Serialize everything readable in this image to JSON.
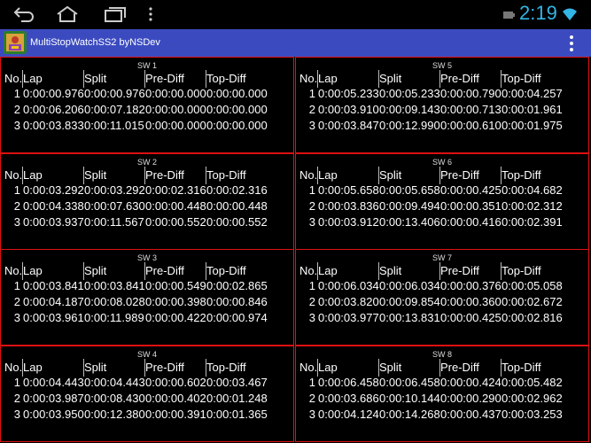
{
  "status_bar": {
    "time": "2:19"
  },
  "app": {
    "title": "MultiStopWatchSS2 byNSDev"
  },
  "columns": [
    "No.",
    "Lap",
    "Split",
    "Pre-Diff",
    "Top-Diff"
  ],
  "stopwatches": [
    {
      "title": "SW 1",
      "rows": [
        {
          "no": "1",
          "lap": "0:00:00.976",
          "split": "0:00:00.976",
          "pre": "0:00:00.000",
          "top": "0:00:00.000"
        },
        {
          "no": "2",
          "lap": "0:00:06.206",
          "split": "0:00:07.182",
          "pre": "0:00:00.000",
          "top": "0:00:00.000"
        },
        {
          "no": "3",
          "lap": "0:00:03.833",
          "split": "0:00:11.015",
          "pre": "0:00:00.000",
          "top": "0:00:00.000"
        }
      ]
    },
    {
      "title": "SW 5",
      "rows": [
        {
          "no": "1",
          "lap": "0:00:05.233",
          "split": "0:00:05.233",
          "pre": "0:00:00.790",
          "top": "0:00:04.257"
        },
        {
          "no": "2",
          "lap": "0:00:03.910",
          "split": "0:00:09.143",
          "pre": "0:00:00.713",
          "top": "0:00:01.961"
        },
        {
          "no": "3",
          "lap": "0:00:03.847",
          "split": "0:00:12.990",
          "pre": "0:00:00.610",
          "top": "0:00:01.975"
        }
      ]
    },
    {
      "title": "SW 2",
      "rows": [
        {
          "no": "1",
          "lap": "0:00:03.292",
          "split": "0:00:03.292",
          "pre": "0:00:02.316",
          "top": "0:00:02.316"
        },
        {
          "no": "2",
          "lap": "0:00:04.338",
          "split": "0:00:07.630",
          "pre": "0:00:00.448",
          "top": "0:00:00.448"
        },
        {
          "no": "3",
          "lap": "0:00:03.937",
          "split": "0:00:11.567",
          "pre": "0:00:00.552",
          "top": "0:00:00.552"
        }
      ]
    },
    {
      "title": "SW 6",
      "rows": [
        {
          "no": "1",
          "lap": "0:00:05.658",
          "split": "0:00:05.658",
          "pre": "0:00:00.425",
          "top": "0:00:04.682"
        },
        {
          "no": "2",
          "lap": "0:00:03.836",
          "split": "0:00:09.494",
          "pre": "0:00:00.351",
          "top": "0:00:02.312"
        },
        {
          "no": "3",
          "lap": "0:00:03.912",
          "split": "0:00:13.406",
          "pre": "0:00:00.416",
          "top": "0:00:02.391"
        }
      ]
    },
    {
      "title": "SW 3",
      "rows": [
        {
          "no": "1",
          "lap": "0:00:03.841",
          "split": "0:00:03.841",
          "pre": "0:00:00.549",
          "top": "0:00:02.865"
        },
        {
          "no": "2",
          "lap": "0:00:04.187",
          "split": "0:00:08.028",
          "pre": "0:00:00.398",
          "top": "0:00:00.846"
        },
        {
          "no": "3",
          "lap": "0:00:03.961",
          "split": "0:00:11.989",
          "pre": "0:00:00.422",
          "top": "0:00:00.974"
        }
      ]
    },
    {
      "title": "SW 7",
      "rows": [
        {
          "no": "1",
          "lap": "0:00:06.034",
          "split": "0:00:06.034",
          "pre": "0:00:00.376",
          "top": "0:00:05.058"
        },
        {
          "no": "2",
          "lap": "0:00:03.820",
          "split": "0:00:09.854",
          "pre": "0:00:00.360",
          "top": "0:00:02.672"
        },
        {
          "no": "3",
          "lap": "0:00:03.977",
          "split": "0:00:13.831",
          "pre": "0:00:00.425",
          "top": "0:00:02.816"
        }
      ]
    },
    {
      "title": "SW 4",
      "rows": [
        {
          "no": "1",
          "lap": "0:00:04.443",
          "split": "0:00:04.443",
          "pre": "0:00:00.602",
          "top": "0:00:03.467"
        },
        {
          "no": "2",
          "lap": "0:00:03.987",
          "split": "0:00:08.430",
          "pre": "0:00:00.402",
          "top": "0:00:01.248"
        },
        {
          "no": "3",
          "lap": "0:00:03.950",
          "split": "0:00:12.380",
          "pre": "0:00:00.391",
          "top": "0:00:01.365"
        }
      ]
    },
    {
      "title": "SW 8",
      "rows": [
        {
          "no": "1",
          "lap": "0:00:06.458",
          "split": "0:00:06.458",
          "pre": "0:00:00.424",
          "top": "0:00:05.482"
        },
        {
          "no": "2",
          "lap": "0:00:03.686",
          "split": "0:00:10.144",
          "pre": "0:00:00.290",
          "top": "0:00:02.962"
        },
        {
          "no": "3",
          "lap": "0:00:04.124",
          "split": "0:00:14.268",
          "pre": "0:00:00.437",
          "top": "0:00:03.253"
        }
      ]
    }
  ],
  "colors": {
    "action_bar": "#3b4bbf",
    "panel_border": "#d11111",
    "clock": "#33b5e5"
  }
}
